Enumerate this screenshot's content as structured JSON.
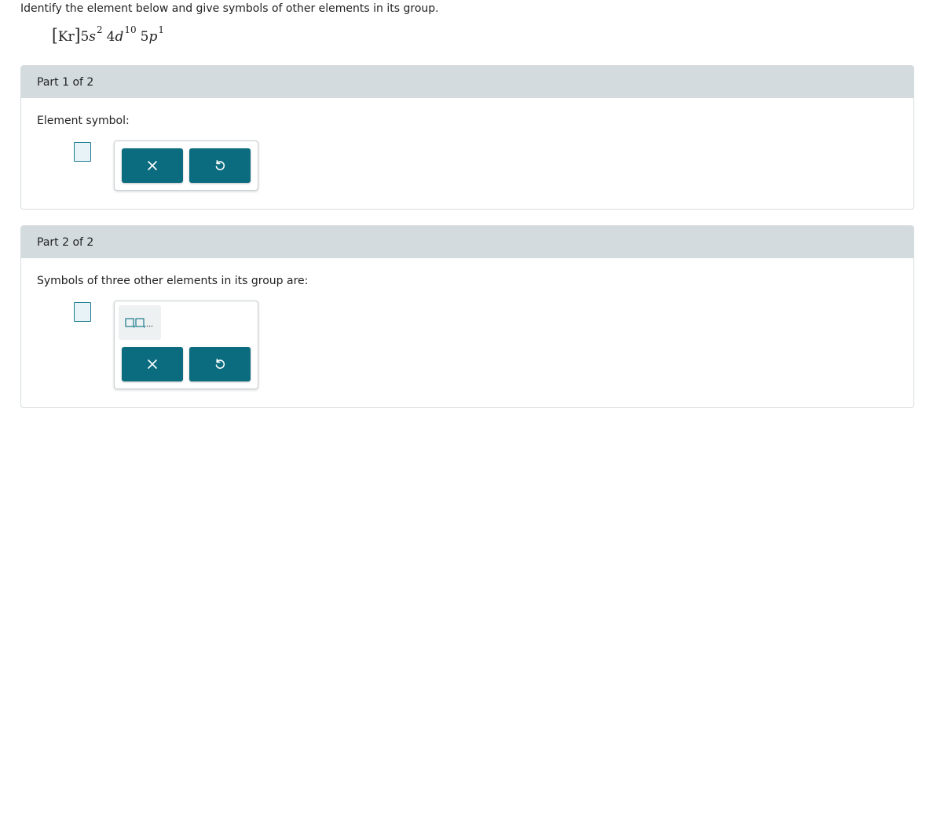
{
  "question": {
    "text": "Identify the element below and give symbols of other elements in its group."
  },
  "configuration": {
    "core": "Kr",
    "orbitals": [
      {
        "n": "5",
        "l": "s",
        "electrons": "2"
      },
      {
        "n": "4",
        "l": "d",
        "electrons": "10"
      },
      {
        "n": "5",
        "l": "p",
        "electrons": "1"
      }
    ]
  },
  "parts": [
    {
      "header": "Part 1 of 2",
      "prompt": "Element symbol:"
    },
    {
      "header": "Part 2 of 2",
      "prompt": "Symbols of three other elements in its group are:"
    }
  ],
  "icons": {
    "clear": "close-icon",
    "undo": "undo-icon",
    "template": "comma-list-template-icon"
  },
  "colors": {
    "accent": "#0a6c7e",
    "header_bg": "#d3dbde",
    "input_border": "#1b7c8e",
    "input_bg": "#e7f3f7"
  }
}
